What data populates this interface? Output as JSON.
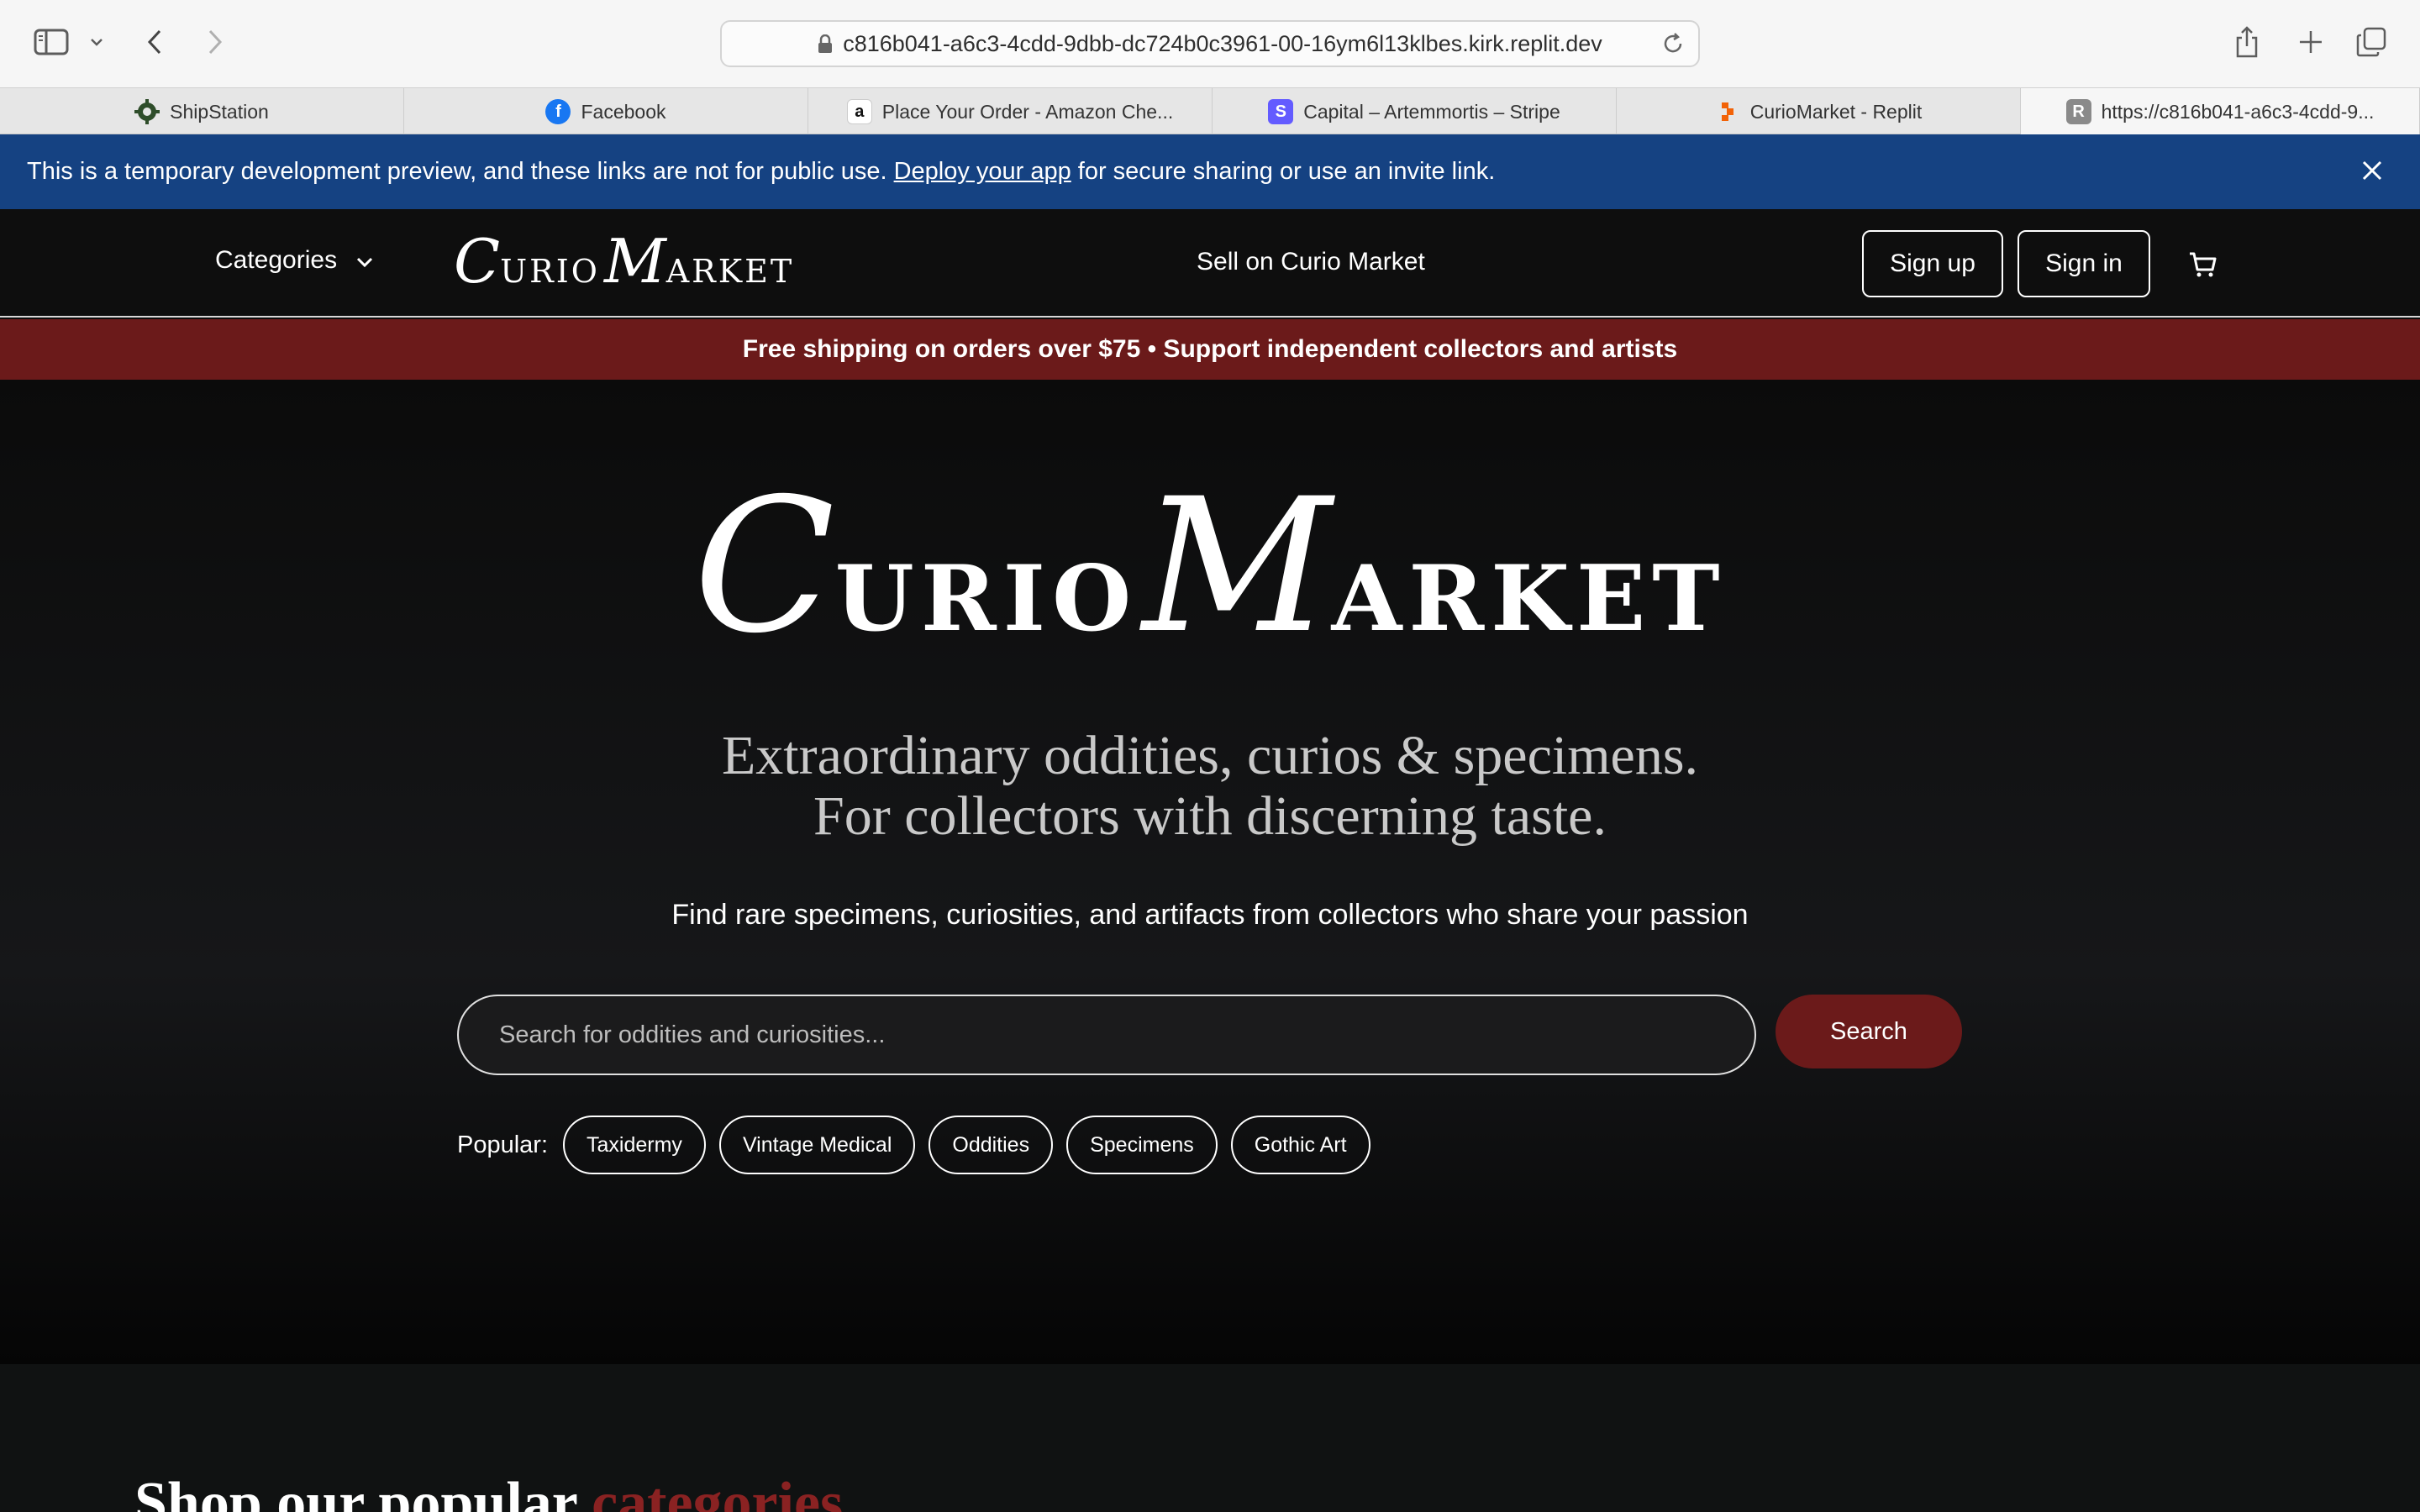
{
  "browser": {
    "url": "c816b041-a6c3-4cdd-9dbb-dc724b0c3961-00-16ym6l13klbes.kirk.replit.dev",
    "tabs": [
      {
        "label": "ShipStation",
        "favicon": "shipstation-icon",
        "color": "#2e4d2a"
      },
      {
        "label": "Facebook",
        "favicon": "facebook-icon",
        "color": "#1877f2"
      },
      {
        "label": "Place Your Order - Amazon Che...",
        "favicon": "amazon-icon",
        "color": "#111111"
      },
      {
        "label": "Capital – Artemmortis – Stripe",
        "favicon": "stripe-icon",
        "color": "#635bff"
      },
      {
        "label": "CurioMarket - Replit",
        "favicon": "replit-icon",
        "color": "#f26207"
      },
      {
        "label": "https://c816b041-a6c3-4cdd-9...",
        "favicon": "r-icon",
        "color": "#8a8a8a"
      }
    ]
  },
  "dev_banner": {
    "text_before": "This is a temporary development preview, and these links are not for public use.",
    "link": "Deploy your app",
    "text_after": "for secure sharing or use an invite link."
  },
  "nav": {
    "categories_label": "Categories",
    "logo": {
      "c": "C",
      "urio": "URIO",
      "m": "M",
      "arket": "ARKET"
    },
    "sell_label": "Sell on Curio Market",
    "signup_label": "Sign up",
    "signin_label": "Sign in"
  },
  "promo": {
    "text": "Free shipping on orders over $75 • Support independent collectors and artists"
  },
  "hero": {
    "logo": {
      "c": "C",
      "urio": "URIO",
      "m": "M",
      "arket": "ARKET"
    },
    "tagline_1": "Extraordinary oddities, curios & specimens.",
    "tagline_2": "For collectors with discerning taste.",
    "subline": "Find rare specimens, curiosities, and artifacts from collectors who share your passion",
    "search_placeholder": "Search for oddities and curiosities...",
    "search_button": "Search",
    "popular_label": "Popular:",
    "popular_tags": [
      "Taxidermy",
      "Vintage Medical",
      "Oddities",
      "Specimens",
      "Gothic Art"
    ]
  },
  "categories_section": {
    "heading_main": "Shop our popular",
    "heading_accent": "categories"
  },
  "colors": {
    "accent": "#6b1a1a",
    "banner_blue": "#154282"
  }
}
